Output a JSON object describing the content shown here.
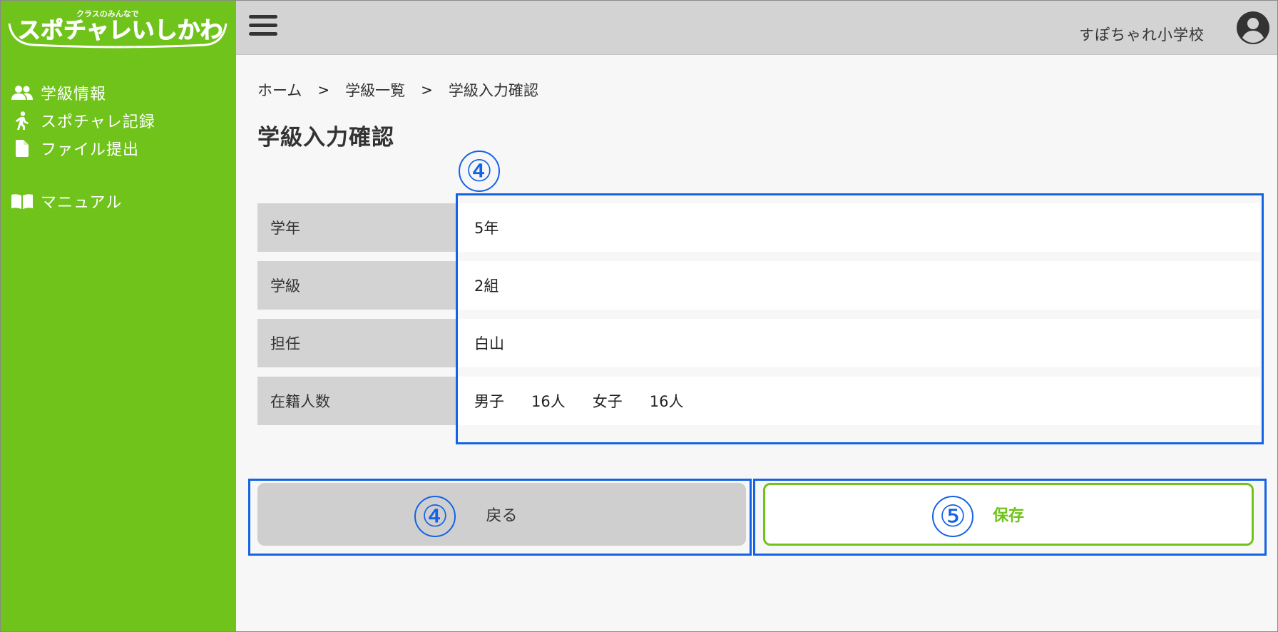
{
  "logo": {
    "tagline": "クラスのみんなで",
    "name": "スポチャレいしかわ"
  },
  "sidebar": {
    "items": [
      {
        "label": "学級情報",
        "icon": "users-icon"
      },
      {
        "label": "スポチャレ記録",
        "icon": "walking-icon"
      },
      {
        "label": "ファイル提出",
        "icon": "file-icon"
      },
      {
        "label": "マニュアル",
        "icon": "book-icon"
      }
    ]
  },
  "header": {
    "school_name": "すぽちゃれ小学校"
  },
  "breadcrumb": {
    "items": [
      "ホーム",
      "学級一覧",
      "学級入力確認"
    ],
    "separator": ">"
  },
  "page": {
    "title": "学級入力確認"
  },
  "details": [
    {
      "label": "学年",
      "value": "5年"
    },
    {
      "label": "学級",
      "value": "2組"
    },
    {
      "label": "担任",
      "value": "白山"
    },
    {
      "label": "在籍人数",
      "boys_label": "男子",
      "boys_count": "16人",
      "girls_label": "女子",
      "girls_count": "16人"
    }
  ],
  "buttons": {
    "back_label": "戻る",
    "save_label": "保存"
  },
  "annotations": {
    "details_marker": "④",
    "back_marker": "④",
    "save_marker": "⑤"
  },
  "colors": {
    "brand_green": "#6fc31a",
    "header_gray": "#d3d3d3",
    "annotation_blue": "#1463e6"
  }
}
